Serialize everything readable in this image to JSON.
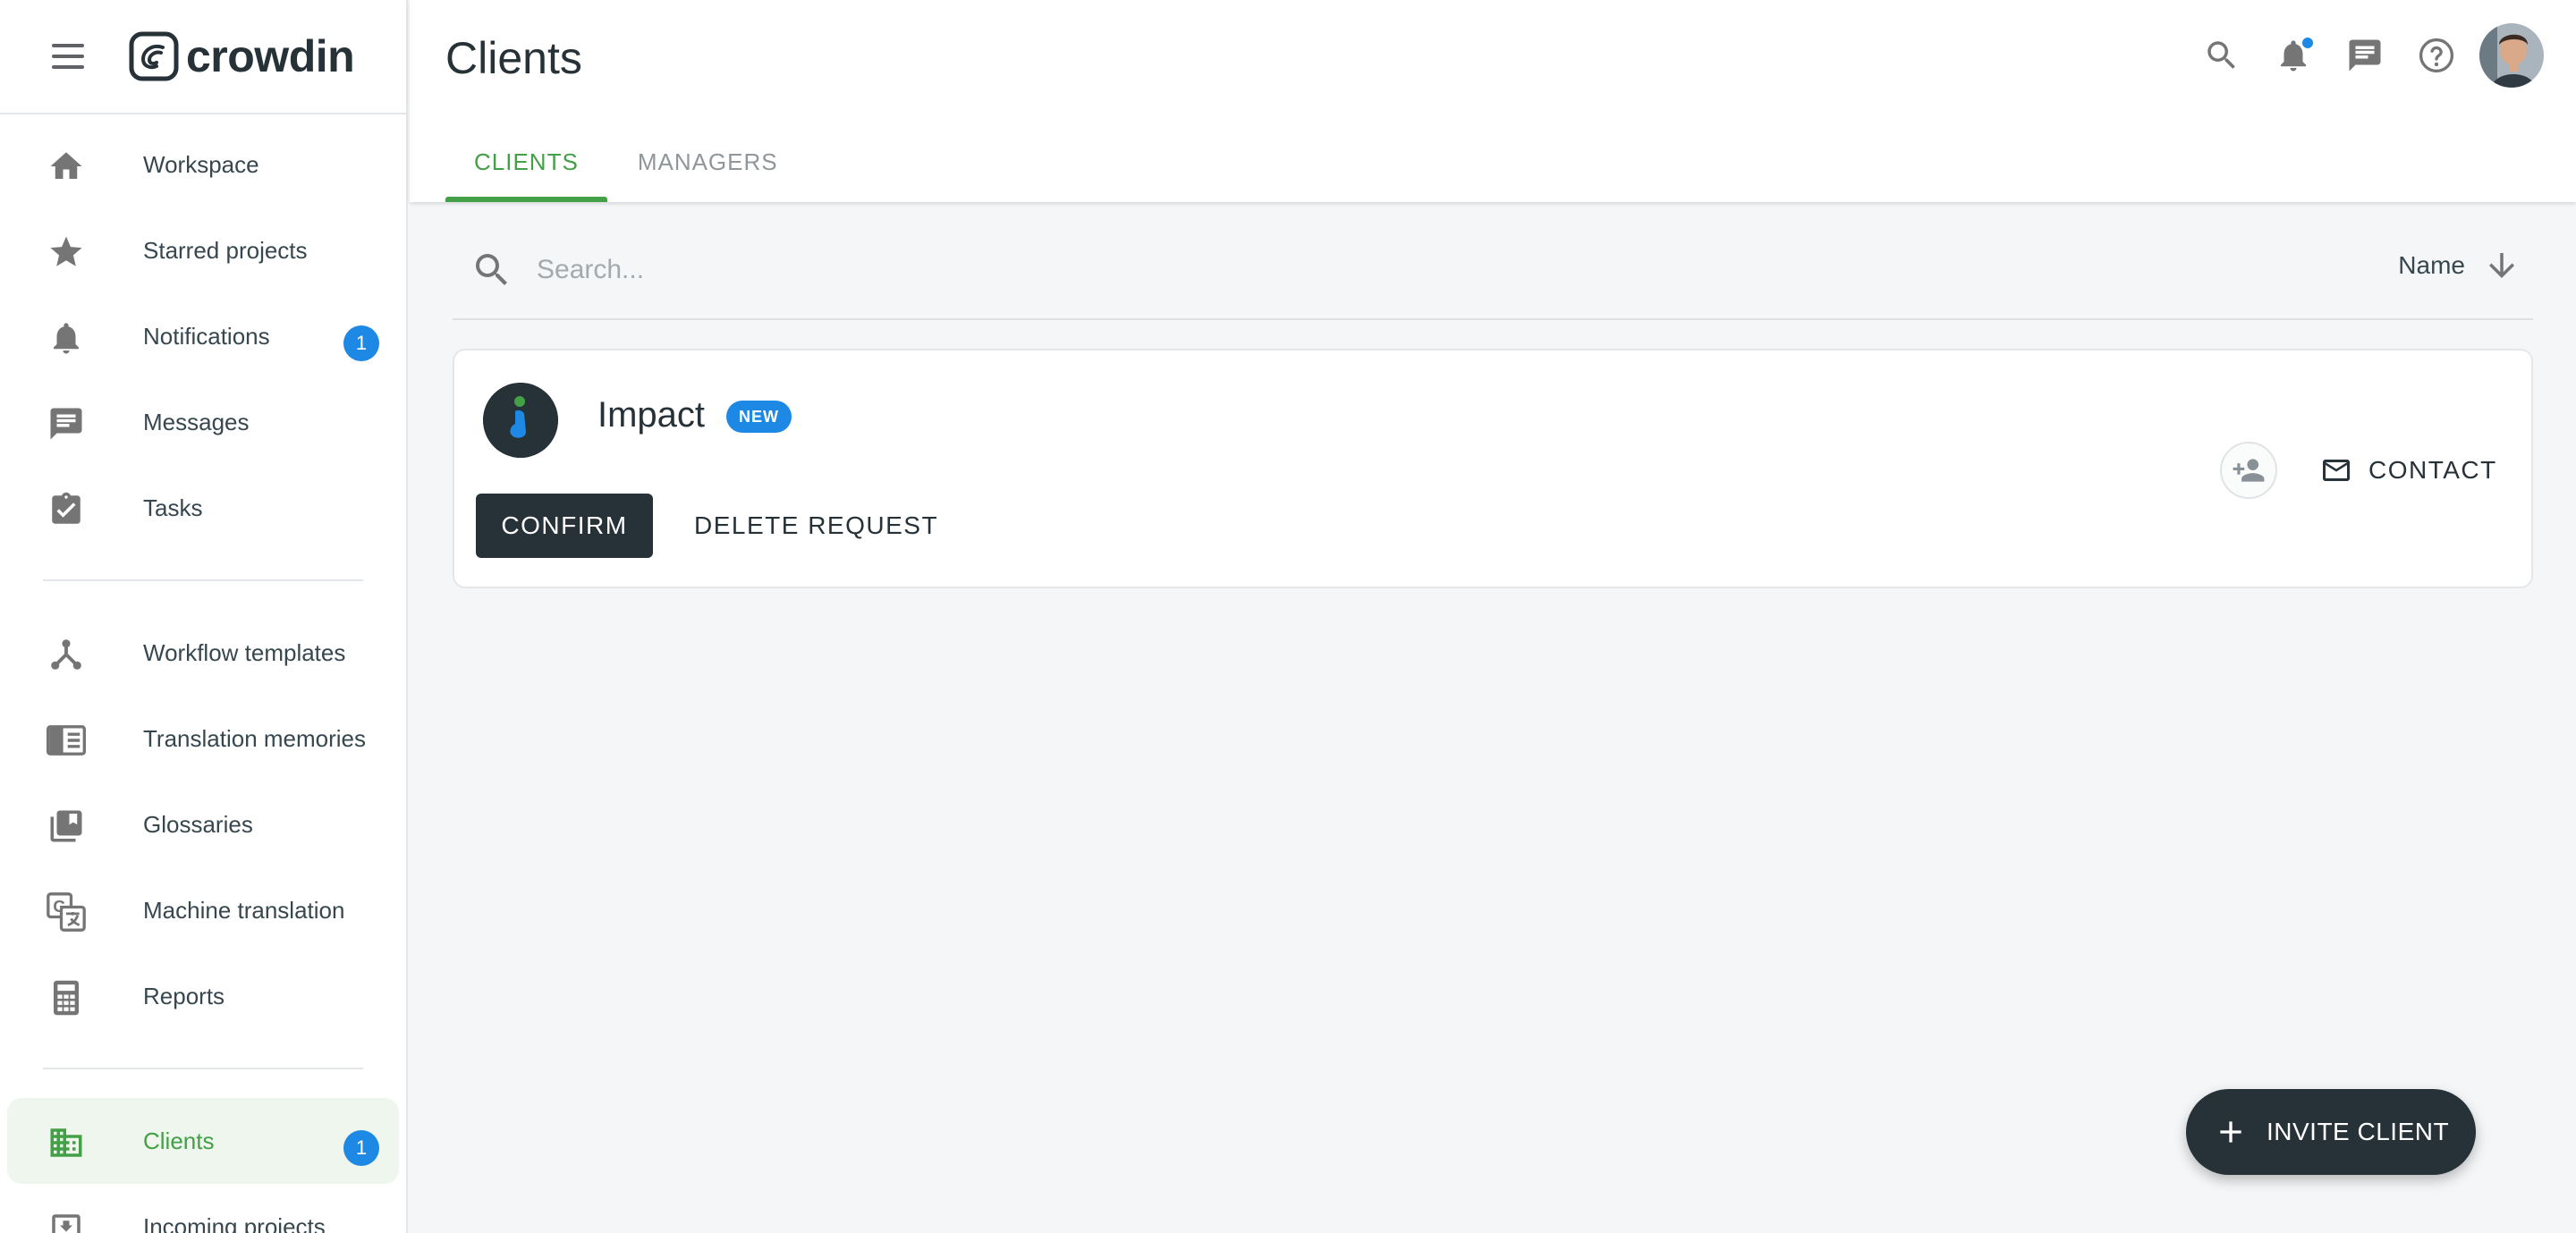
{
  "app": {
    "name": "crowdin"
  },
  "sidebar": {
    "items": [
      {
        "label": "Workspace",
        "icon": "home-icon"
      },
      {
        "label": "Starred projects",
        "icon": "star-icon"
      },
      {
        "label": "Notifications",
        "icon": "bell-icon",
        "badge": "1"
      },
      {
        "label": "Messages",
        "icon": "message-icon"
      },
      {
        "label": "Tasks",
        "icon": "tasks-icon"
      },
      {
        "label": "Workflow templates",
        "icon": "workflow-icon"
      },
      {
        "label": "Translation memories",
        "icon": "translation-memory-icon"
      },
      {
        "label": "Glossaries",
        "icon": "glossary-icon"
      },
      {
        "label": "Machine translation",
        "icon": "machine-translation-icon"
      },
      {
        "label": "Reports",
        "icon": "calculator-icon"
      },
      {
        "label": "Clients",
        "icon": "building-icon",
        "badge": "1",
        "active": true
      },
      {
        "label": "Incoming projects",
        "icon": "inbox-icon"
      }
    ]
  },
  "header": {
    "title": "Clients",
    "tabs": [
      {
        "label": "CLIENTS",
        "active": true
      },
      {
        "label": "MANAGERS",
        "active": false
      }
    ]
  },
  "search": {
    "placeholder": "Search...",
    "value": "",
    "sort_label": "Name"
  },
  "clients": [
    {
      "name": "Impact",
      "badge": "NEW",
      "confirm_label": "CONFIRM",
      "delete_label": "DELETE REQUEST",
      "contact_label": "CONTACT"
    }
  ],
  "fab": {
    "label": "INVITE CLIENT"
  },
  "colors": {
    "accent": "#43a047",
    "badge": "#1e88e5",
    "dark": "#263238"
  }
}
